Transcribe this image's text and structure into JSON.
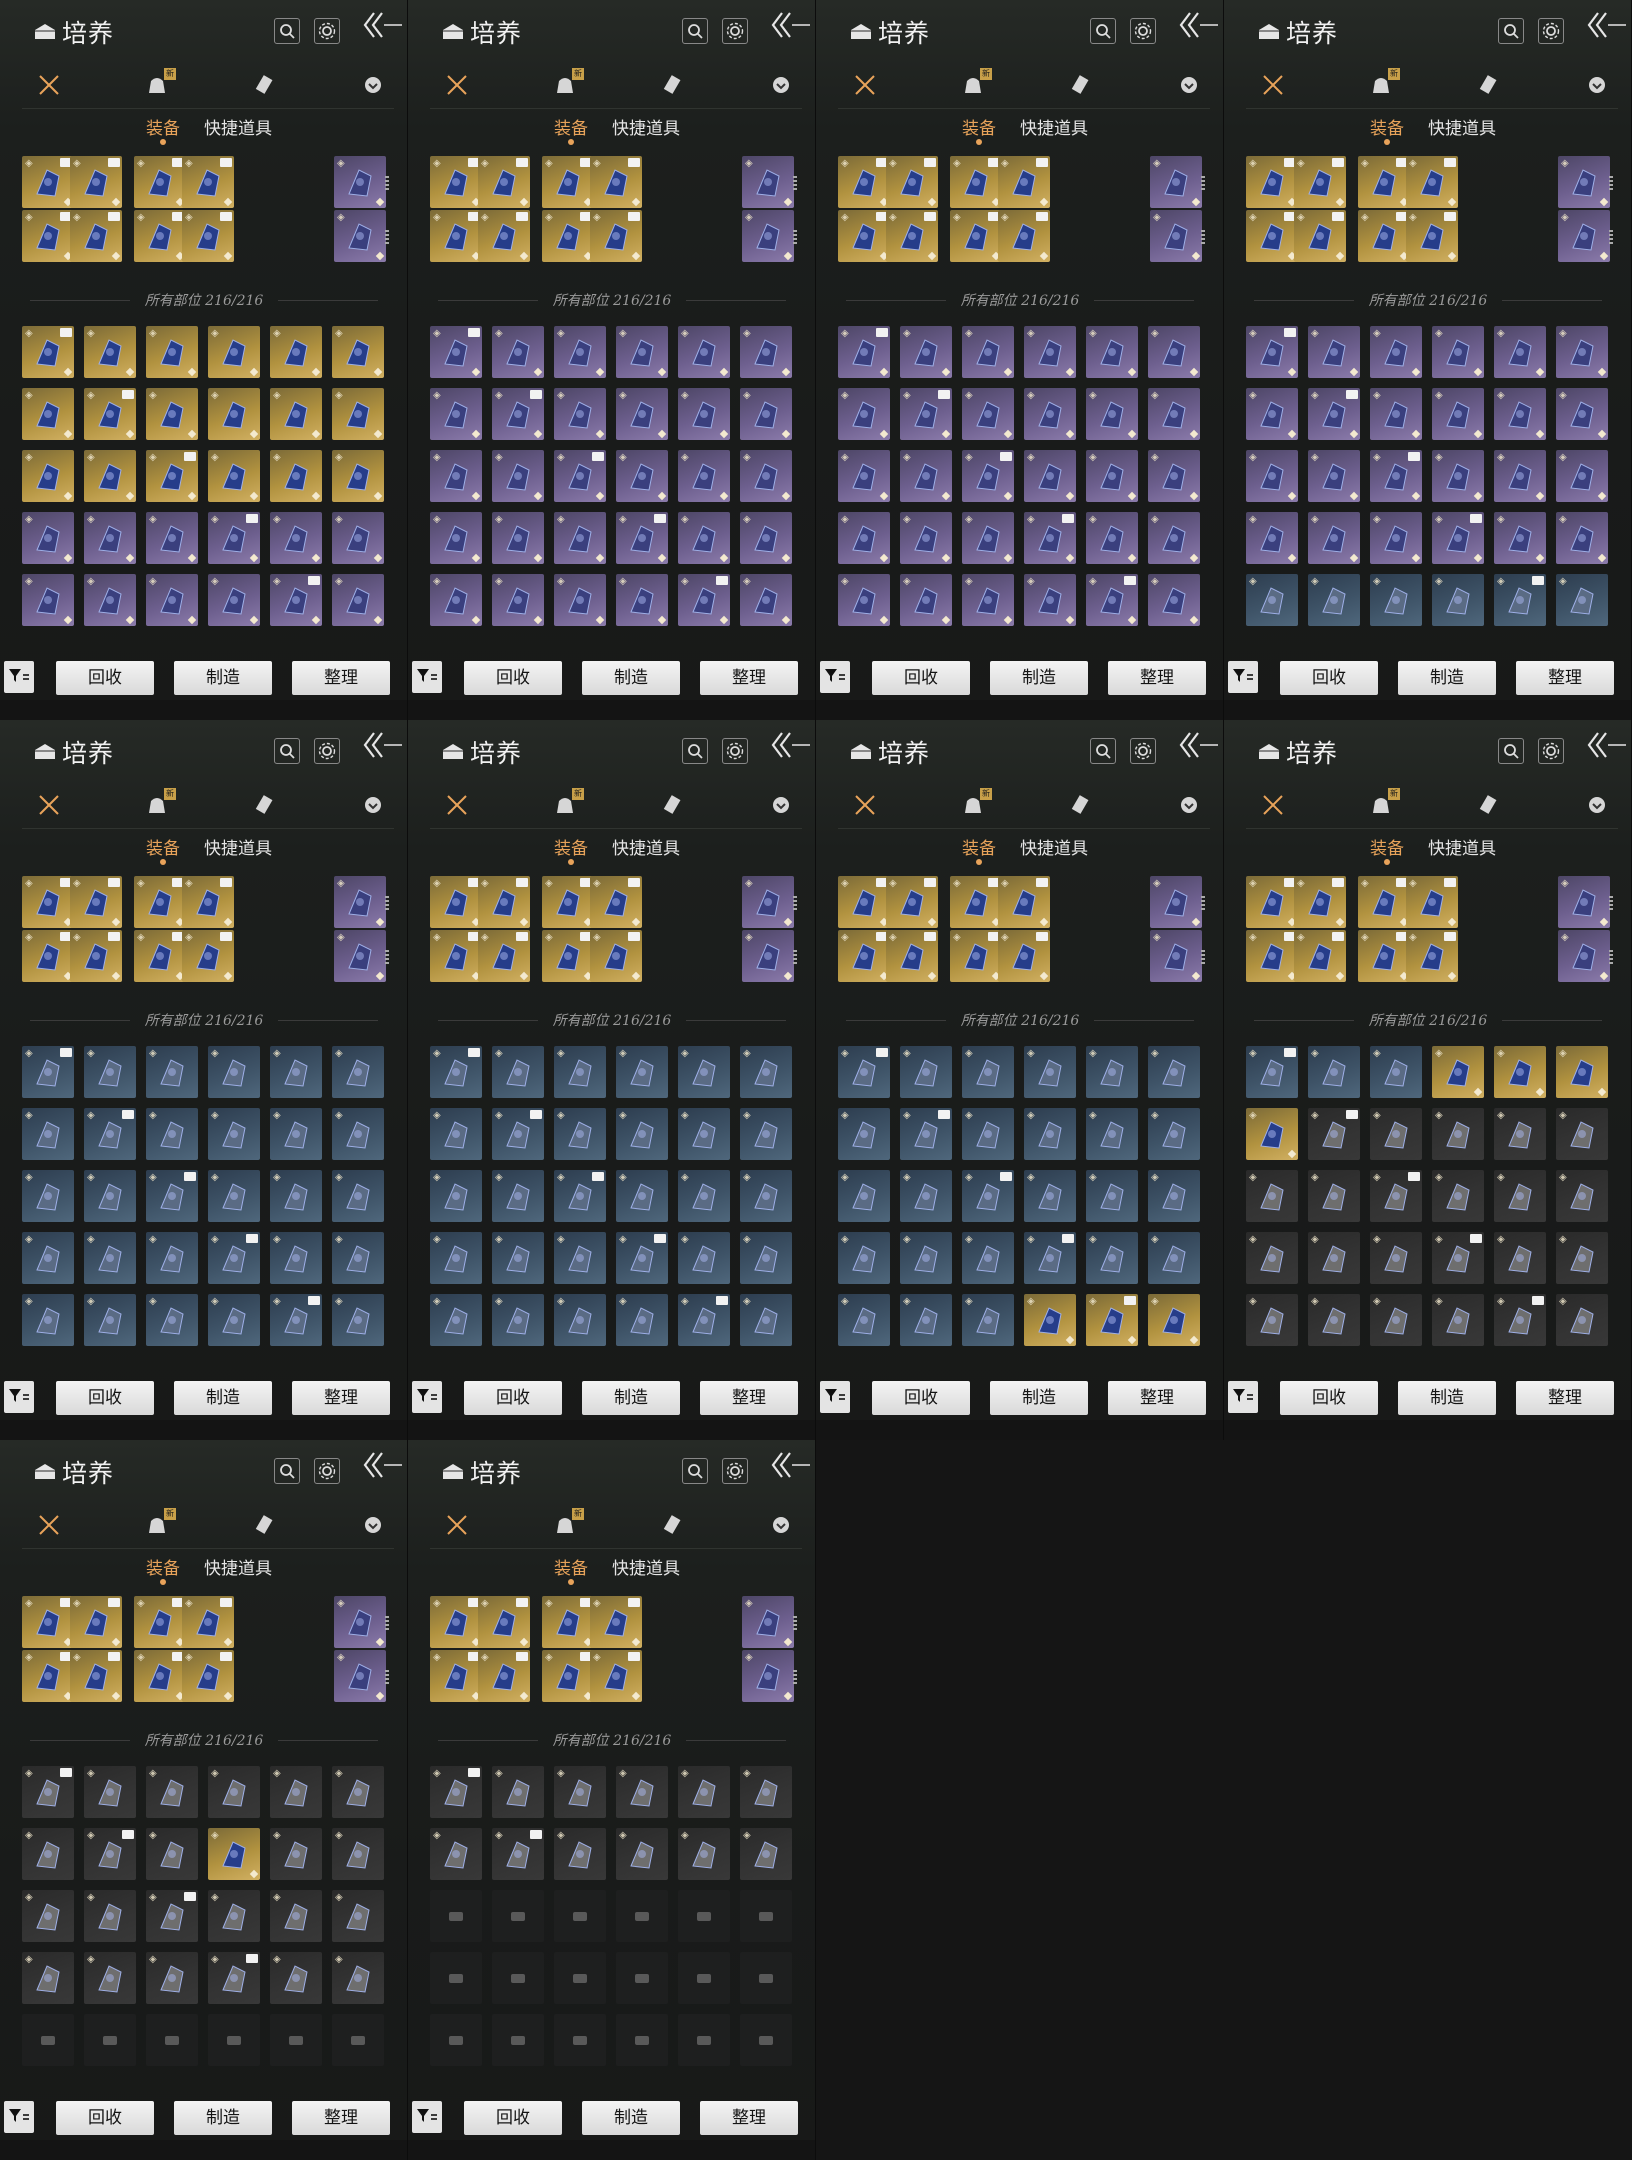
{
  "screen": {
    "title": "培养"
  },
  "panels_count": 10,
  "header": {
    "title": "培养",
    "icons": [
      "chest-icon",
      "search-icon",
      "gear-icon",
      "back-arrows-icon"
    ]
  },
  "categories": [
    {
      "name": "weapons",
      "icon": "crossed-swords-icon",
      "badge": ""
    },
    {
      "name": "bag",
      "icon": "pouch-icon",
      "badge": "新"
    },
    {
      "name": "scroll",
      "icon": "scroll-icon",
      "badge": ""
    },
    {
      "name": "misc",
      "icon": "shield-token-icon",
      "badge": ""
    }
  ],
  "subtabs": {
    "equip": "装备",
    "quick_items": "快捷道具"
  },
  "divider_label": "所有部位 216/216",
  "footer": {
    "recycle": "回收",
    "craft": "制造",
    "sort": "整理"
  },
  "panels": [
    {
      "grid_rarities": [
        "gold",
        "gold",
        "gold",
        "gold",
        "gold",
        "gold",
        "gold",
        "gold",
        "gold",
        "gold",
        "gold",
        "gold",
        "gold",
        "gold",
        "gold",
        "gold",
        "gold",
        "gold",
        "purple",
        "purple",
        "purple",
        "purple",
        "purple",
        "purple",
        "purple",
        "purple",
        "purple",
        "purple",
        "purple",
        "purple"
      ]
    },
    {
      "grid_rarities": [
        "purple",
        "purple",
        "purple",
        "purple",
        "purple",
        "purple",
        "purple",
        "purple",
        "purple",
        "purple",
        "purple",
        "purple",
        "purple",
        "purple",
        "purple",
        "purple",
        "purple",
        "purple",
        "purple",
        "purple",
        "purple",
        "purple",
        "purple",
        "purple",
        "purple",
        "purple",
        "purple",
        "purple",
        "purple",
        "purple"
      ]
    },
    {
      "grid_rarities": [
        "purple",
        "purple",
        "purple",
        "purple",
        "purple",
        "purple",
        "purple",
        "purple",
        "purple",
        "purple",
        "purple",
        "purple",
        "purple",
        "purple",
        "purple",
        "purple",
        "purple",
        "purple",
        "purple",
        "purple",
        "purple",
        "purple",
        "purple",
        "purple",
        "purple",
        "purple",
        "purple",
        "purple",
        "purple",
        "purple"
      ]
    },
    {
      "grid_rarities": [
        "purple",
        "purple",
        "purple",
        "purple",
        "purple",
        "purple",
        "purple",
        "purple",
        "purple",
        "purple",
        "purple",
        "purple",
        "purple",
        "purple",
        "purple",
        "purple",
        "purple",
        "purple",
        "purple",
        "purple",
        "purple",
        "purple",
        "purple",
        "purple",
        "blue",
        "blue",
        "blue",
        "blue",
        "blue",
        "blue"
      ]
    },
    {
      "grid_rarities": [
        "blue",
        "blue",
        "blue",
        "blue",
        "blue",
        "blue",
        "blue",
        "blue",
        "blue",
        "blue",
        "blue",
        "blue",
        "blue",
        "blue",
        "blue",
        "blue",
        "blue",
        "blue",
        "blue",
        "blue",
        "blue",
        "blue",
        "blue",
        "blue",
        "blue",
        "blue",
        "blue",
        "blue",
        "blue",
        "blue"
      ]
    },
    {
      "grid_rarities": [
        "blue",
        "blue",
        "blue",
        "blue",
        "blue",
        "blue",
        "blue",
        "blue",
        "blue",
        "blue",
        "blue",
        "blue",
        "blue",
        "blue",
        "blue",
        "blue",
        "blue",
        "blue",
        "blue",
        "blue",
        "blue",
        "blue",
        "blue",
        "blue",
        "blue",
        "blue",
        "blue",
        "blue",
        "blue",
        "blue"
      ]
    },
    {
      "grid_rarities": [
        "blue",
        "blue",
        "blue",
        "blue",
        "blue",
        "blue",
        "blue",
        "blue",
        "blue",
        "blue",
        "blue",
        "blue",
        "blue",
        "blue",
        "blue",
        "blue",
        "blue",
        "blue",
        "blue",
        "blue",
        "blue",
        "blue",
        "blue",
        "blue",
        "blue",
        "blue",
        "blue",
        "gold",
        "gold",
        "gold"
      ]
    },
    {
      "grid_rarities": [
        "blue",
        "blue",
        "blue",
        "gold",
        "gold",
        "gold",
        "gold",
        "dark",
        "dark",
        "dark",
        "dark",
        "dark",
        "dark",
        "dark",
        "dark",
        "dark",
        "dark",
        "dark",
        "dark",
        "dark",
        "dark",
        "dark",
        "dark",
        "dark",
        "dark",
        "dark",
        "dark",
        "dark",
        "dark",
        "dark"
      ]
    },
    {
      "grid_rarities": [
        "dark",
        "dark",
        "dark",
        "dark",
        "dark",
        "dark",
        "dark",
        "dark",
        "dark",
        "gold",
        "dark",
        "dark",
        "dark",
        "dark",
        "dark",
        "dark",
        "dark",
        "dark",
        "dark",
        "dark",
        "dark",
        "dark",
        "dark",
        "dark",
        "empty",
        "empty",
        "empty",
        "empty",
        "empty",
        "empty"
      ]
    },
    {
      "grid_rarities": [
        "dark",
        "dark",
        "dark",
        "dark",
        "dark",
        "dark",
        "dark",
        "dark",
        "dark",
        "dark",
        "dark",
        "dark",
        "empty",
        "empty",
        "empty",
        "empty",
        "empty",
        "empty",
        "empty",
        "empty",
        "empty",
        "empty",
        "empty",
        "empty",
        "empty",
        "empty",
        "empty",
        "empty",
        "empty",
        "empty"
      ]
    }
  ],
  "equipped_rarities": [
    "gold",
    "gold",
    "gold",
    "gold",
    "purple",
    "gold",
    "gold",
    "gold",
    "gold",
    "purple"
  ],
  "colors": {
    "accent": "#e8a35a",
    "gold": "#b1923f",
    "purple": "#6d5f8e",
    "blue": "#3e5367",
    "bg": "#1c1f1d"
  }
}
